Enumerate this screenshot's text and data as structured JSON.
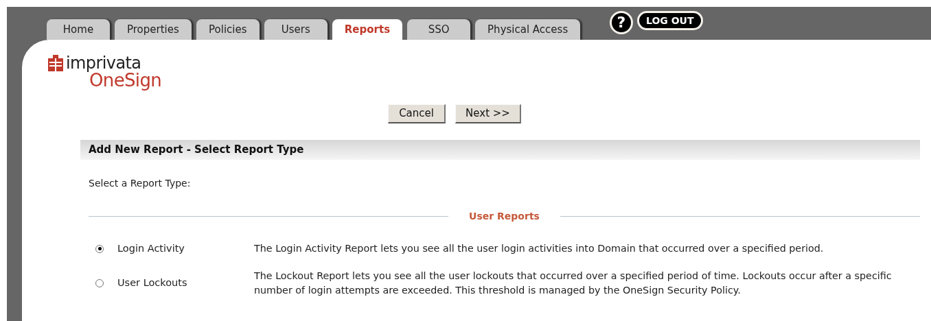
{
  "tabs": [
    {
      "label": "Home",
      "selected": false
    },
    {
      "label": "Properties",
      "selected": false
    },
    {
      "label": "Policies",
      "selected": false
    },
    {
      "label": "Users",
      "selected": false
    },
    {
      "label": "Reports",
      "selected": true
    },
    {
      "label": "SSO",
      "selected": false
    },
    {
      "label": "Physical Access",
      "selected": false
    }
  ],
  "help": "?",
  "logout": "LOG OUT",
  "logo": {
    "brand": "imprivata",
    "product": "OneSign"
  },
  "buttons": [
    "Cancel",
    "Next >>"
  ],
  "panel": {
    "title": "Add New Report - Select Report Type",
    "prompt": "Select a Report Type:",
    "section": "User Reports",
    "options": [
      {
        "label": "Login Activity",
        "selected": true,
        "description": "The Login Activity Report lets you see all the user login activities into Domain that occurred over a specified period."
      },
      {
        "label": "User Lockouts",
        "selected": false,
        "description": "The Lockout Report lets you see all the user lockouts that occurred over a specified period of time. Lockouts occur after a specific number of login attempts are exceeded. This threshold is managed by the OneSign Security Policy."
      }
    ]
  }
}
